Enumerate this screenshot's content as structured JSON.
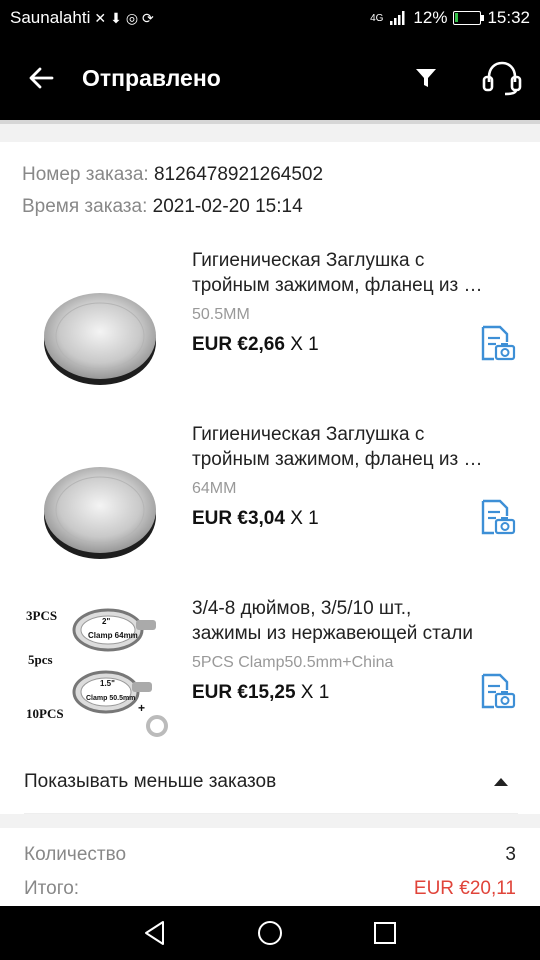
{
  "status_bar": {
    "carrier": "Saunalahti",
    "network": "4G",
    "battery": "12%",
    "battery_level": 0.12,
    "time": "15:32"
  },
  "header": {
    "title": "Отправлено",
    "back_icon": "arrow-left-icon",
    "filter_icon": "filter-icon",
    "support_icon": "headset-icon"
  },
  "order": {
    "number_label": "Номер заказа:",
    "number": "8126478921264502",
    "time_label": "Время заказа:",
    "time": "2021-02-20 15:14"
  },
  "items": [
    {
      "name_line1": "Гигиеническая Заглушка с",
      "name_line2": "тройным зажимом, фланец из …",
      "sku": "50.5MM",
      "price": "EUR €2,66",
      "qty": "X 1"
    },
    {
      "name_line1": "Гигиеническая Заглушка с",
      "name_line2": "тройным зажимом, фланец из …",
      "sku": "64MM",
      "price": "EUR €3,04",
      "qty": "X 1"
    },
    {
      "name_line1": "3/4-8 дюймов, 3/5/10 шт.,",
      "name_line2": "зажимы из нержавеющей стали",
      "sku": "5PCS Clamp50.5mm+China",
      "price": "EUR €15,25",
      "qty": "X 1",
      "thumb_labels": [
        "3PCS",
        "5pcs",
        "10PCS",
        "2\"",
        "Clamp 64mm",
        "1.5\"",
        "Clamp 50.5mm",
        "+"
      ]
    }
  ],
  "toggle": {
    "label": "Показывать меньше заказов"
  },
  "summary": {
    "qty_label": "Количество",
    "qty_value": "3",
    "total_label": "Итого:",
    "total_value": "EUR €20,11",
    "total_color": "#e0443a"
  },
  "accent_color": "#3d8fd6"
}
